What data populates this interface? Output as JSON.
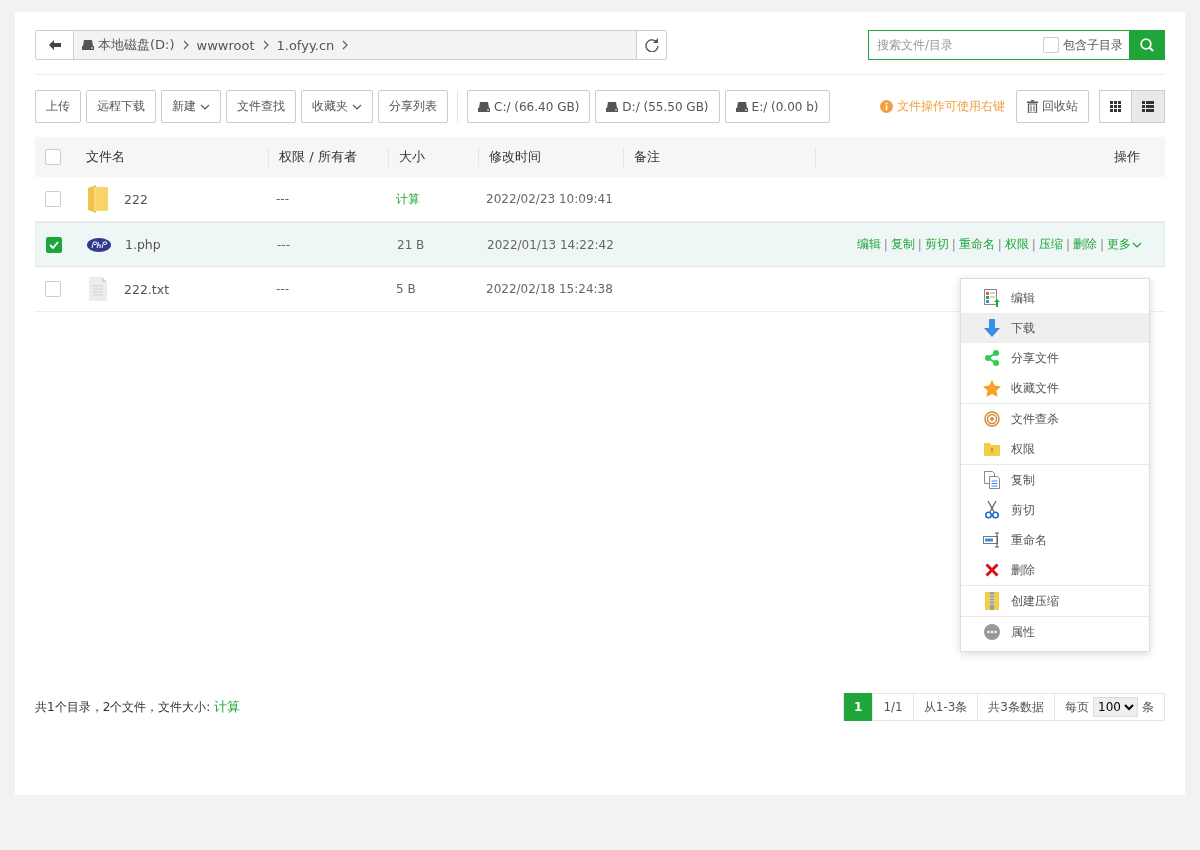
{
  "path_bar": {
    "crumbs": [
      "本地磁盘(D:)",
      "wwwroot",
      "1.ofyy.cn"
    ]
  },
  "search": {
    "placeholder": "搜索文件/目录",
    "include_subdirs": {
      "label": "包含子目录",
      "checked": false
    }
  },
  "toolbar": {
    "buttons": [
      {
        "label": "上传",
        "dropdown": false
      },
      {
        "label": "远程下载",
        "dropdown": false
      },
      {
        "label": "新建",
        "dropdown": true
      },
      {
        "label": "文件查找",
        "dropdown": false
      },
      {
        "label": "收藏夹",
        "dropdown": true
      },
      {
        "label": "分享列表",
        "dropdown": false
      }
    ],
    "drives": [
      "C:/ (66.40 GB)",
      "D:/ (55.50 GB)",
      "E:/ (0.00 b)"
    ],
    "hint": "文件操作可使用右键",
    "recycle": "回收站",
    "views": [
      {
        "kind": "grid",
        "selected": false
      },
      {
        "kind": "list",
        "selected": true
      }
    ]
  },
  "table": {
    "select_all": {
      "checked": false
    },
    "columns": [
      "文件名",
      "权限 / 所有者",
      "大小",
      "修改时间",
      "备注",
      "操作"
    ],
    "rows": [
      {
        "kind": "folder",
        "checked": false,
        "name": "222",
        "permission": "---",
        "size": "计算",
        "size_is_link": true,
        "modified": "2022/02/23 10:09:41",
        "actions": []
      },
      {
        "kind": "php",
        "checked": true,
        "name": "1.php",
        "permission": "---",
        "size": "21 B",
        "size_is_link": false,
        "modified": "2022/01/13 14:22:42",
        "actions": [
          {
            "label": "编辑"
          },
          {
            "separator": "|",
            "label": "复制"
          },
          {
            "separator": "|",
            "label": "剪切"
          },
          {
            "separator": "|",
            "label": "重命名"
          },
          {
            "separator": "|",
            "label": "权限"
          },
          {
            "separator": "|",
            "label": "压缩"
          },
          {
            "separator": "|",
            "label": "删除"
          },
          {
            "separator": "|",
            "label": "更多"
          }
        ]
      },
      {
        "kind": "text",
        "checked": false,
        "name": "222.txt",
        "permission": "---",
        "size": "5 B",
        "size_is_link": false,
        "modified": "2022/02/18 15:24:38",
        "actions": []
      }
    ]
  },
  "context_menu": {
    "groups": [
      [
        {
          "kind": "edit",
          "label": "编辑",
          "highlighted": false
        },
        {
          "kind": "download",
          "label": "下载",
          "highlighted": true
        },
        {
          "kind": "share",
          "label": "分享文件",
          "highlighted": false
        },
        {
          "kind": "favorite",
          "label": "收藏文件",
          "highlighted": false
        }
      ],
      [
        {
          "kind": "scan",
          "label": "文件查杀",
          "highlighted": false
        },
        {
          "kind": "permission",
          "label": "权限",
          "highlighted": false
        }
      ],
      [
        {
          "kind": "copy",
          "label": "复制",
          "highlighted": false
        },
        {
          "kind": "cut",
          "label": "剪切",
          "highlighted": false
        },
        {
          "kind": "rename",
          "label": "重命名",
          "highlighted": false
        },
        {
          "kind": "delete",
          "label": "删除",
          "highlighted": false
        }
      ],
      [
        {
          "kind": "compress",
          "label": "创建压缩",
          "highlighted": false
        }
      ],
      [
        {
          "kind": "properties",
          "label": "属性",
          "highlighted": false
        }
      ]
    ]
  },
  "footer": {
    "summary": "共1个目录，2个文件，文件大小:",
    "summary_link": "计算",
    "pages": [
      {
        "label": "1",
        "selected": true
      }
    ],
    "page_count": "1/1",
    "range": "从1-3条",
    "total": "共3条数据",
    "per_page_label": "每页",
    "per_page": "100",
    "per_page_unit": "条"
  }
}
